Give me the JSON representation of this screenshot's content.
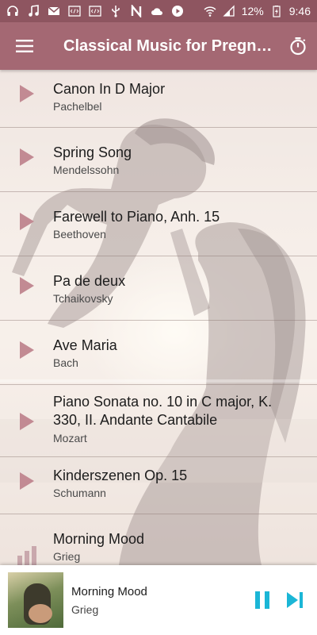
{
  "status_bar": {
    "left_icons": [
      "headphones-icon",
      "music-note-icon",
      "gmail-icon",
      "code-icon",
      "code-icon",
      "usb-icon",
      "n-icon",
      "cloud-icon",
      "play-circle-icon"
    ],
    "battery_percent": "12%",
    "time": "9:46"
  },
  "app_bar": {
    "title": "Classical Music for Pregnancy",
    "menu_icon": "hamburger-menu-icon",
    "timer_icon": "stopwatch-icon",
    "color": "#a46873"
  },
  "tracks": [
    {
      "title": "Canon In D Major",
      "composer": "Pachelbel",
      "state": "play"
    },
    {
      "title": "Spring Song",
      "composer": "Mendelssohn",
      "state": "play"
    },
    {
      "title": "Farewell to Piano, Anh. 15",
      "composer": "Beethoven",
      "state": "play"
    },
    {
      "title": "Pa de deux",
      "composer": "Tchaikovsky",
      "state": "play"
    },
    {
      "title": "Ave Maria",
      "composer": "Bach",
      "state": "play"
    },
    {
      "title": "Piano Sonata no. 10 in C major, K. 330, II. Andante Cantabile",
      "composer": "Mozart",
      "state": "play"
    },
    {
      "title": "Kinderszenen Op. 15",
      "composer": "Schumann",
      "state": "play"
    },
    {
      "title": "Morning Mood",
      "composer": "Grieg",
      "state": "playing"
    }
  ],
  "now_playing": {
    "title": "Morning Mood",
    "artist": "Grieg",
    "controls": [
      "pause-icon",
      "skip-next-icon"
    ],
    "accent": "#1bb6d6"
  }
}
